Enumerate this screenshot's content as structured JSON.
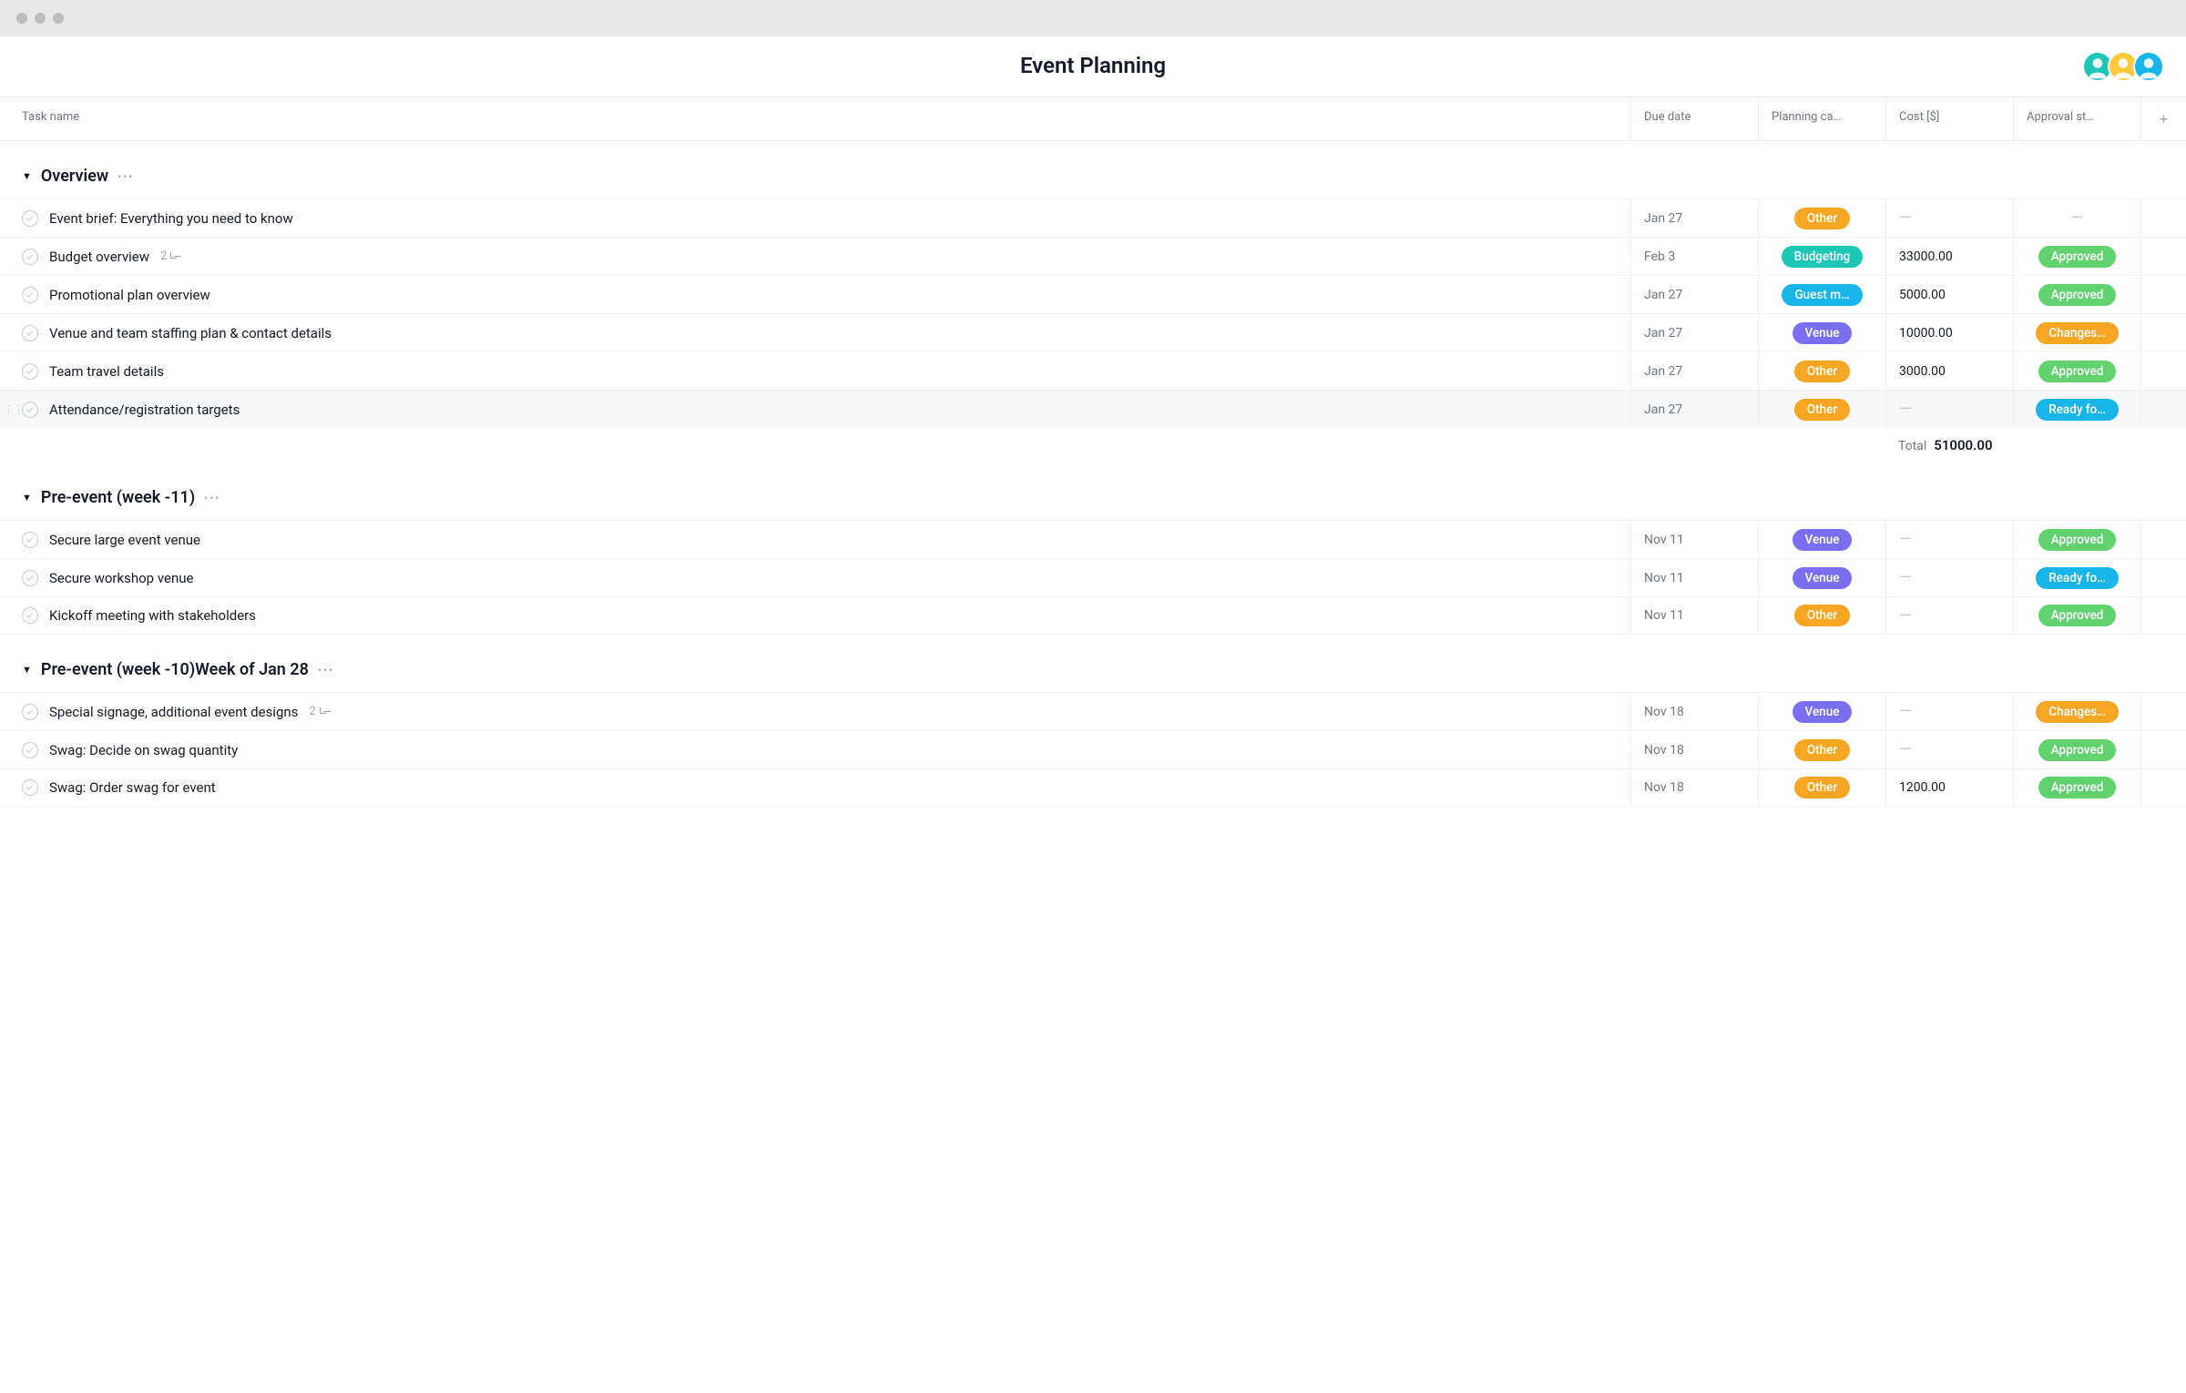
{
  "title": "Event Planning",
  "avatars": [
    {
      "bg": "#1ec6b6"
    },
    {
      "bg": "#ffc93c"
    },
    {
      "bg": "#18b6e8"
    }
  ],
  "columns": {
    "task": "Task name",
    "due": "Due date",
    "category": "Planning ca…",
    "cost": "Cost [$]",
    "approval": "Approval st…"
  },
  "pills": {
    "Other": "#f5a623",
    "Budgeting": "#1ec6b6",
    "Guest m…": "#18b6e8",
    "Venue": "#7a6ff0",
    "Approved": "#62d26f",
    "Changes…": "#f5a623",
    "Ready fo…": "#18b6e8"
  },
  "sections": [
    {
      "title": "Overview",
      "total_label": "Total",
      "total_value": "51000.00",
      "tasks": [
        {
          "name": "Event brief: Everything you need to know",
          "due": "Jan 27",
          "category": "Other",
          "cost": "",
          "approval": ""
        },
        {
          "name": "Budget overview",
          "subtasks": "2",
          "due": "Feb 3",
          "category": "Budgeting",
          "cost": "33000.00",
          "approval": "Approved"
        },
        {
          "name": "Promotional plan overview",
          "due": "Jan 27",
          "category": "Guest m…",
          "cost": "5000.00",
          "approval": "Approved"
        },
        {
          "name": "Venue and team staffing plan & contact details",
          "due": "Jan 27",
          "category": "Venue",
          "cost": "10000.00",
          "approval": "Changes…"
        },
        {
          "name": "Team travel details",
          "due": "Jan 27",
          "category": "Other",
          "cost": "3000.00",
          "approval": "Approved"
        },
        {
          "name": "Attendance/registration targets",
          "due": "Jan 27",
          "category": "Other",
          "cost": "",
          "approval": "Ready fo…",
          "hovered": true
        }
      ]
    },
    {
      "title": "Pre-event (week -11)",
      "tasks": [
        {
          "name": "Secure large event venue",
          "due": "Nov 11",
          "category": "Venue",
          "cost": "",
          "approval": "Approved"
        },
        {
          "name": "Secure workshop venue",
          "due": "Nov 11",
          "category": "Venue",
          "cost": "",
          "approval": "Ready fo…"
        },
        {
          "name": "Kickoff meeting with stakeholders",
          "due": "Nov 11",
          "category": "Other",
          "cost": "",
          "approval": "Approved"
        }
      ]
    },
    {
      "title": "Pre-event (week -10)Week of Jan 28",
      "tasks": [
        {
          "name": "Special signage, additional event designs",
          "subtasks": "2",
          "due": "Nov 18",
          "category": "Venue",
          "cost": "",
          "approval": "Changes…"
        },
        {
          "name": "Swag: Decide on swag quantity",
          "due": "Nov 18",
          "category": "Other",
          "cost": "",
          "approval": "Approved"
        },
        {
          "name": "Swag: Order swag for event",
          "due": "Nov 18",
          "category": "Other",
          "cost": "1200.00",
          "approval": "Approved"
        }
      ]
    }
  ]
}
